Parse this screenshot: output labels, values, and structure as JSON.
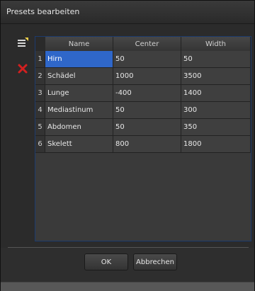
{
  "window": {
    "title": "Presets bearbeiten"
  },
  "toolbar": {
    "add_icon": "add-preset-icon",
    "delete_icon": "delete-preset-icon"
  },
  "table": {
    "columns": [
      "Name",
      "Center",
      "Width"
    ],
    "rows": [
      {
        "num": "1",
        "name": "Hirn",
        "center": "50",
        "width": "50",
        "selected": true
      },
      {
        "num": "2",
        "name": "Schädel",
        "center": "1000",
        "width": "3500"
      },
      {
        "num": "3",
        "name": "Lunge",
        "center": "-400",
        "width": "1400"
      },
      {
        "num": "4",
        "name": "Mediastinum",
        "center": "50",
        "width": "300"
      },
      {
        "num": "5",
        "name": "Abdomen",
        "center": "50",
        "width": "350"
      },
      {
        "num": "6",
        "name": "Skelett",
        "center": "800",
        "width": "1800"
      }
    ]
  },
  "footer": {
    "ok_label": "OK",
    "cancel_label": "Abbrechen"
  },
  "colors": {
    "selection": "#2f67c9",
    "delete_icon": "#d22020"
  }
}
